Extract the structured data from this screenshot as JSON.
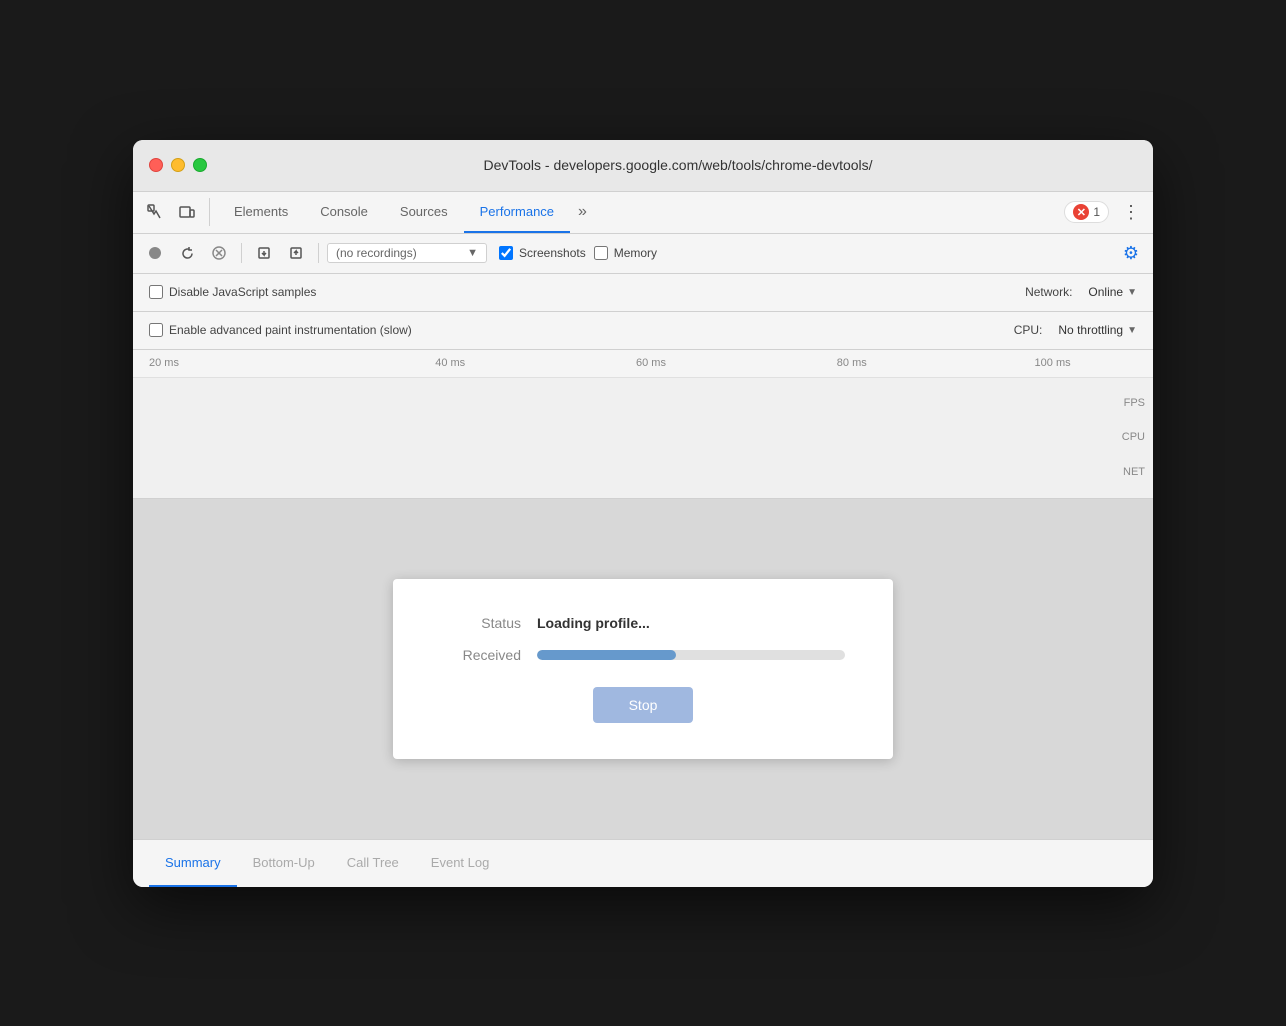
{
  "window": {
    "title": "DevTools - developers.google.com/web/tools/chrome-devtools/"
  },
  "tabs": {
    "items": [
      {
        "label": "Elements"
      },
      {
        "label": "Console"
      },
      {
        "label": "Sources"
      },
      {
        "label": "Performance"
      },
      {
        "label": "»"
      }
    ],
    "active": "Performance",
    "error_count": "1"
  },
  "toolbar": {
    "recording_placeholder": "(no recordings)",
    "screenshots_label": "Screenshots",
    "memory_label": "Memory"
  },
  "settings": {
    "disable_js_samples": "Disable JavaScript samples",
    "enable_advanced_paint": "Enable advanced paint instrumentation (slow)",
    "network_label": "Network:",
    "network_value": "Online",
    "cpu_label": "CPU:",
    "cpu_value": "No throttling"
  },
  "timeline": {
    "ruler_ticks": [
      "20 ms",
      "40 ms",
      "60 ms",
      "80 ms",
      "100 ms"
    ],
    "track_labels": [
      "FPS",
      "CPU",
      "NET"
    ]
  },
  "dialog": {
    "status_label": "Status",
    "status_value": "Loading profile...",
    "received_label": "Received",
    "progress_percent": 45,
    "stop_button": "Stop"
  },
  "bottom_tabs": {
    "items": [
      {
        "label": "Summary"
      },
      {
        "label": "Bottom-Up"
      },
      {
        "label": "Call Tree"
      },
      {
        "label": "Event Log"
      }
    ],
    "active": "Summary"
  }
}
